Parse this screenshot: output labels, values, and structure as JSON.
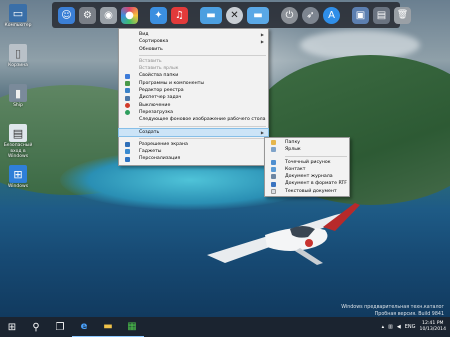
{
  "dock": {
    "icons": [
      {
        "name": "finder-icon",
        "glyph": "☺",
        "bg": "#3b7fd6"
      },
      {
        "name": "settings-icon",
        "glyph": "⚙",
        "bg": "#7a7f87"
      },
      {
        "name": "disk-icon",
        "glyph": "◉",
        "bg": "#9aa1a8"
      },
      {
        "name": "gamecenter-icon",
        "glyph": "●",
        "bg": "#e0436a"
      },
      {
        "name": "safari-icon",
        "glyph": "✦",
        "bg": "#3b8fe0"
      },
      {
        "name": "itunes-icon",
        "glyph": "♫",
        "bg": "#e23a3a"
      },
      {
        "name": "folder-icon",
        "glyph": "▬",
        "bg": "#4c9fe0"
      },
      {
        "name": "x-icon",
        "glyph": "✕",
        "bg": "#c9ced4"
      },
      {
        "name": "folder-blue-icon",
        "glyph": "▬",
        "bg": "#5aa8e6"
      },
      {
        "name": "power-icon",
        "glyph": "⏻",
        "bg": "#8b9097"
      },
      {
        "name": "rocket-icon",
        "glyph": "➶",
        "bg": "#7d8590"
      },
      {
        "name": "appstore-icon",
        "glyph": "A",
        "bg": "#2f8ee8"
      },
      {
        "name": "window-icon",
        "glyph": "▣",
        "bg": "#5c7fb0"
      },
      {
        "name": "display-icon",
        "glyph": "▤",
        "bg": "#6a7380"
      },
      {
        "name": "trash-icon",
        "glyph": "🗑",
        "bg": "#9aa0a6"
      }
    ]
  },
  "desktop_icons": [
    {
      "label": "Компьютер",
      "glyph": "▭",
      "bg": "#3a6fa8"
    },
    {
      "label": "Корзина",
      "glyph": "▯",
      "bg": "#b9c1c8"
    },
    {
      "label": "Ship",
      "glyph": "▮",
      "bg": "#7a8a9a"
    },
    {
      "label": "Безопасный вход в Windows",
      "glyph": "▤",
      "bg": "#dfe6ec"
    },
    {
      "label": "Windows",
      "glyph": "⊞",
      "bg": "#2f7fd8"
    }
  ],
  "context_menu": {
    "items": [
      {
        "label": "Вид",
        "disabled": false,
        "submenu": true,
        "icon": ""
      },
      {
        "label": "Сортировка",
        "disabled": false,
        "submenu": true,
        "icon": ""
      },
      {
        "label": "Обновить",
        "disabled": false,
        "submenu": false,
        "icon": ""
      },
      {
        "sep": true
      },
      {
        "label": "Вставить",
        "disabled": true,
        "submenu": false,
        "icon": ""
      },
      {
        "label": "Вставить ярлык",
        "disabled": true,
        "submenu": false,
        "icon": ""
      },
      {
        "label": "Свойства папки",
        "disabled": false,
        "submenu": false,
        "icon": "#3d7bd9"
      },
      {
        "label": "Программы и компоненты",
        "disabled": false,
        "submenu": false,
        "icon": "#4a9a4a"
      },
      {
        "label": "Редактор реестра",
        "disabled": false,
        "submenu": false,
        "icon": "#3a82c8"
      },
      {
        "label": "Диспетчер задач",
        "disabled": false,
        "submenu": false,
        "icon": "#4a76a8"
      },
      {
        "label": "Выключение",
        "disabled": false,
        "submenu": false,
        "icon": "#d23b2b"
      },
      {
        "label": "Перезагрузка",
        "disabled": false,
        "submenu": false,
        "icon": "#2f9e5d"
      },
      {
        "label": "Следующее фоновое изображение рабочего стола",
        "disabled": false,
        "submenu": false,
        "icon": ""
      },
      {
        "sep": true
      },
      {
        "label": "Создать",
        "disabled": false,
        "submenu": true,
        "icon": "",
        "highlight": true
      },
      {
        "sep": true
      },
      {
        "label": "Разрешение экрана",
        "disabled": false,
        "submenu": false,
        "icon": "#2f6fb8"
      },
      {
        "label": "Гаджеты",
        "disabled": false,
        "submenu": false,
        "icon": "#3a8ad0"
      },
      {
        "label": "Персонализация",
        "disabled": false,
        "submenu": false,
        "icon": "#2e73c2"
      }
    ]
  },
  "submenu": {
    "items": [
      {
        "label": "Папку",
        "icon": "#e6b64c"
      },
      {
        "label": "Ярлык",
        "icon": "#7fa3c9"
      },
      {
        "sep": true
      },
      {
        "label": "Точечный рисунок",
        "icon": "#4f8fd0"
      },
      {
        "label": "Контакт",
        "icon": "#5a9bd6"
      },
      {
        "label": "Документ журнала",
        "icon": "#6c86a3"
      },
      {
        "label": "Документ в формате RTF",
        "icon": "#3b74c0"
      },
      {
        "label": "Текстовый документ",
        "icon": "#d9dde2"
      }
    ]
  },
  "watermark": {
    "line1": "Windows предварительная техн.каталог",
    "line2": "Пробная версия. Build 9841"
  },
  "taskbar": {
    "buttons": [
      {
        "name": "start-button",
        "glyph": "⊞"
      },
      {
        "name": "search-button",
        "glyph": "⚲"
      },
      {
        "name": "task-view-button",
        "glyph": "❐"
      },
      {
        "name": "ie-button",
        "glyph": "e"
      },
      {
        "name": "explorer-button",
        "glyph": "▬"
      },
      {
        "name": "store-button",
        "glyph": "▦"
      }
    ],
    "tray": {
      "lang": "ENG"
    },
    "clock": {
      "time": "12:41 PM",
      "date": "10/13/2014"
    }
  }
}
